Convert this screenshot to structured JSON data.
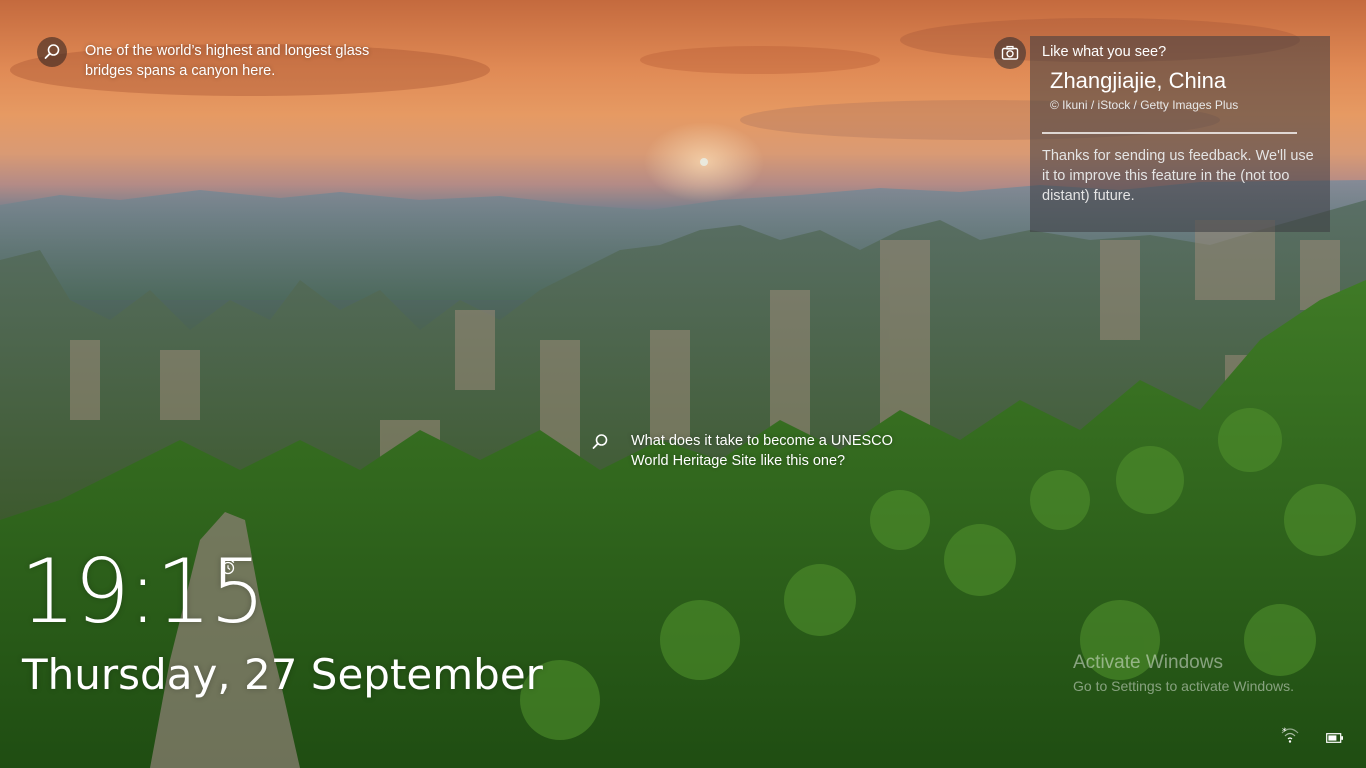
{
  "lock_screen": {
    "hotspot_top": {
      "text": "One of the world’s highest and longest glass bridges spans a canyon here.",
      "icon": "search-icon"
    },
    "hotspot_mid": {
      "text": "What does it take to become a UNESCO World Heritage Site like this one?",
      "icon": "search-icon"
    },
    "info_card": {
      "prompt": "Like what you see?",
      "location": "Zhangjiajie, China",
      "credit": "© Ikuni / iStock / Getty Images Plus",
      "feedback": "Thanks for sending us feedback. We'll use it to improve this feature in the (not too distant) future.",
      "icon": "camera-icon"
    },
    "time": "19:15",
    "date": "Thursday, 27 September",
    "alarm_icon": "alarm-clock-icon"
  },
  "watermark": {
    "title": "Activate Windows",
    "subtitle": "Go to Settings to activate Windows."
  },
  "status_icons": {
    "network": "network-icon",
    "battery": "battery-icon"
  },
  "colors": {
    "sky_top": "#c46a3e",
    "sky_glow": "#e69a63",
    "forest": "#2f5a1f",
    "panel": "#3c3c42"
  }
}
